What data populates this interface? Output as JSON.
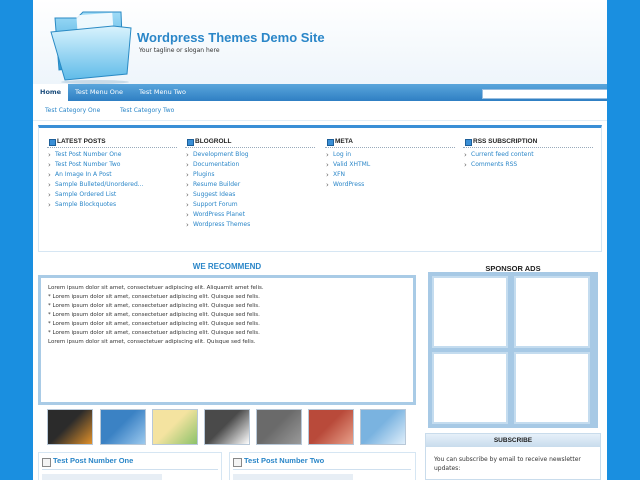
{
  "header": {
    "title": "Wordpress Themes Demo Site",
    "tagline": "Your tagline or slogan here"
  },
  "nav": {
    "items": [
      {
        "label": "Home",
        "active": true
      },
      {
        "label": "Test Menu One",
        "active": false
      },
      {
        "label": "Test Menu Two",
        "active": false
      }
    ]
  },
  "subnav": {
    "items": [
      {
        "label": "Test Category One"
      },
      {
        "label": "Test Category Two"
      }
    ]
  },
  "widgets": {
    "latest_posts": {
      "title": "LATEST POSTS",
      "items": [
        "Test Post Number One",
        "Test Post Number Two",
        "An Image In A Post",
        "Sample Bulleted/Unordered...",
        "Sample Ordered List",
        "Sample Blockquotes"
      ]
    },
    "blogroll": {
      "title": "BLOGROLL",
      "items": [
        "Development Blog",
        "Documentation",
        "Plugins",
        "Resume Builder",
        "Suggest Ideas",
        "Support Forum",
        "WordPress Planet",
        "Wordpress Themes"
      ]
    },
    "meta": {
      "title": "META",
      "items": [
        "Log in",
        "Valid XHTML",
        "XFN",
        "WordPress"
      ]
    },
    "rss": {
      "title": "RSS SUBSCRIPTION",
      "items": [
        "Current feed content",
        "Comments RSS"
      ]
    }
  },
  "recommend": {
    "title": "WE RECOMMEND",
    "lines": [
      "Lorem ipsum dolor sit amet, consectetuer adipiscing elit. Aliquamit amet felis.",
      "* Lorem ipsum dolor sit amet, consectetuer adipiscing elit. Quisque sed felis.",
      "* Lorem ipsum dolor sit amet, consectetuer adipiscing elit. Quisque sed felis.",
      "* Lorem ipsum dolor sit amet, consectetuer adipiscing elit. Quisque sed felis.",
      "* Lorem ipsum dolor sit amet, consectetuer adipiscing elit. Quisque sed felis.",
      "* Lorem ipsum dolor sit amet, consectetuer adipiscing elit. Quisque sed felis.",
      "Lorem ipsum dolor sit amet, consectetuer adipiscing elit. Quisque sed felis."
    ]
  },
  "thumbnails": [
    {
      "theme": "dark-orange",
      "colors": [
        "#2b2b2b",
        "#e0902a"
      ]
    },
    {
      "theme": "blue",
      "colors": [
        "#3b82c4",
        "#9cc9ee"
      ]
    },
    {
      "theme": "map",
      "colors": [
        "#f4e3a0",
        "#8cc26a"
      ]
    },
    {
      "theme": "dark-gray",
      "colors": [
        "#4a4a4a",
        "#ffffff"
      ]
    },
    {
      "theme": "gray",
      "colors": [
        "#6a6a6a",
        "#9a9a9a"
      ]
    },
    {
      "theme": "red",
      "colors": [
        "#b94a3a",
        "#e8a08a"
      ]
    },
    {
      "theme": "light-blue",
      "colors": [
        "#7ab3e0",
        "#dfeefa"
      ]
    }
  ],
  "posts": [
    {
      "title": "Test Post Number One"
    },
    {
      "title": "Test Post Number Two"
    }
  ],
  "sidebar": {
    "sponsor_title": "SPONSOR ADS",
    "subscribe_title": "SUBSCRIBE",
    "subscribe_text": "You can subscribe by email to receive newsletter updates:"
  },
  "colors": {
    "background": "#1a8fe0",
    "accent": "#2a86c8",
    "nav": "#2f7fc3"
  }
}
